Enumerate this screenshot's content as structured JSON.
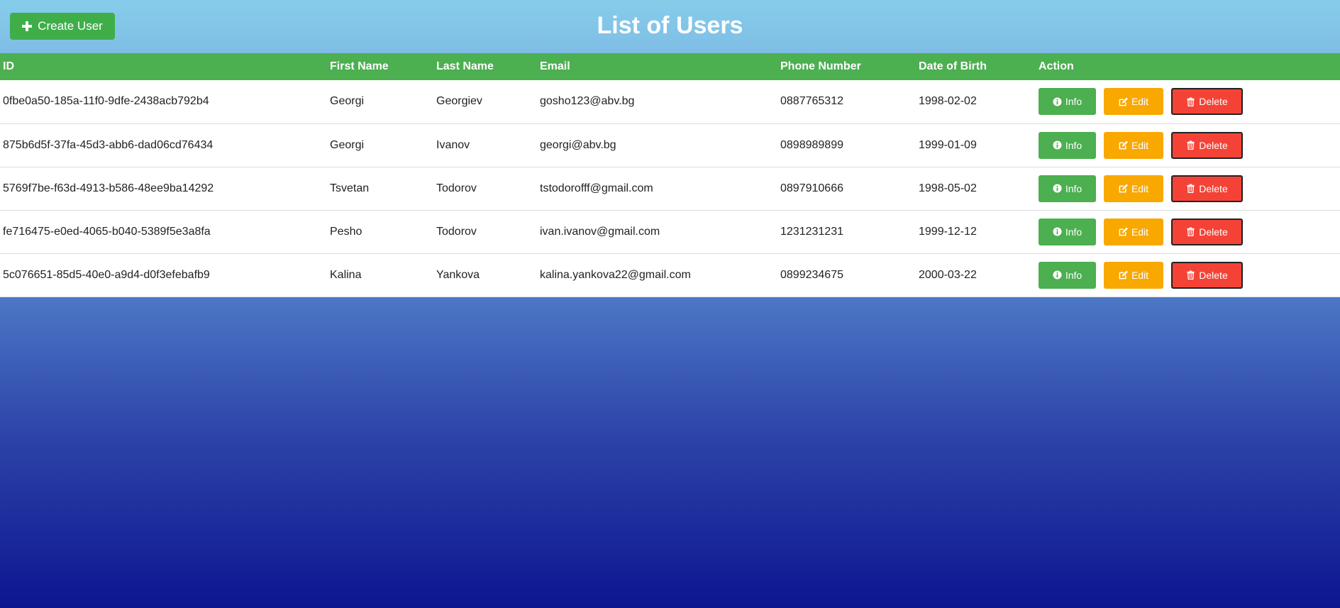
{
  "header": {
    "title": "List of Users",
    "create_label": "Create User"
  },
  "table": {
    "columns": [
      "ID",
      "First Name",
      "Last Name",
      "Email",
      "Phone Number",
      "Date of Birth",
      "Action"
    ],
    "rows": [
      {
        "id": "0fbe0a50-185a-11f0-9dfe-2438acb792b4",
        "first": "Georgi",
        "last": "Georgiev",
        "email": "gosho123@abv.bg",
        "phone": "0887765312",
        "dob": "1998-02-02"
      },
      {
        "id": "875b6d5f-37fa-45d3-abb6-dad06cd76434",
        "first": "Georgi",
        "last": "Ivanov",
        "email": "georgi@abv.bg",
        "phone": "0898989899",
        "dob": "1999-01-09"
      },
      {
        "id": "5769f7be-f63d-4913-b586-48ee9ba14292",
        "first": "Tsvetan",
        "last": "Todorov",
        "email": "tstodorofff@gmail.com",
        "phone": "0897910666",
        "dob": "1998-05-02"
      },
      {
        "id": "fe716475-e0ed-4065-b040-5389f5e3a8fa",
        "first": "Pesho",
        "last": "Todorov",
        "email": "ivan.ivanov@gmail.com",
        "phone": "1231231231",
        "dob": "1999-12-12"
      },
      {
        "id": "5c076651-85d5-40e0-a9d4-d0f3efebafb9",
        "first": "Kalina",
        "last": "Yankova",
        "email": "kalina.yankova22@gmail.com",
        "phone": "0899234675",
        "dob": "2000-03-22"
      }
    ],
    "action_labels": {
      "info": "Info",
      "edit": "Edit",
      "delete": "Delete"
    }
  },
  "icons": {
    "create": "plus-icon",
    "info": "info-circle-icon",
    "edit": "edit-icon",
    "delete": "trash-icon"
  },
  "colors": {
    "header_bar": "#4caf50",
    "create_button": "#3fae49",
    "info_button": "#4caf50",
    "edit_button": "#f9a800",
    "delete_button": "#f44336",
    "background_top": "#86cdea",
    "background_bottom": "#0d1690"
  }
}
